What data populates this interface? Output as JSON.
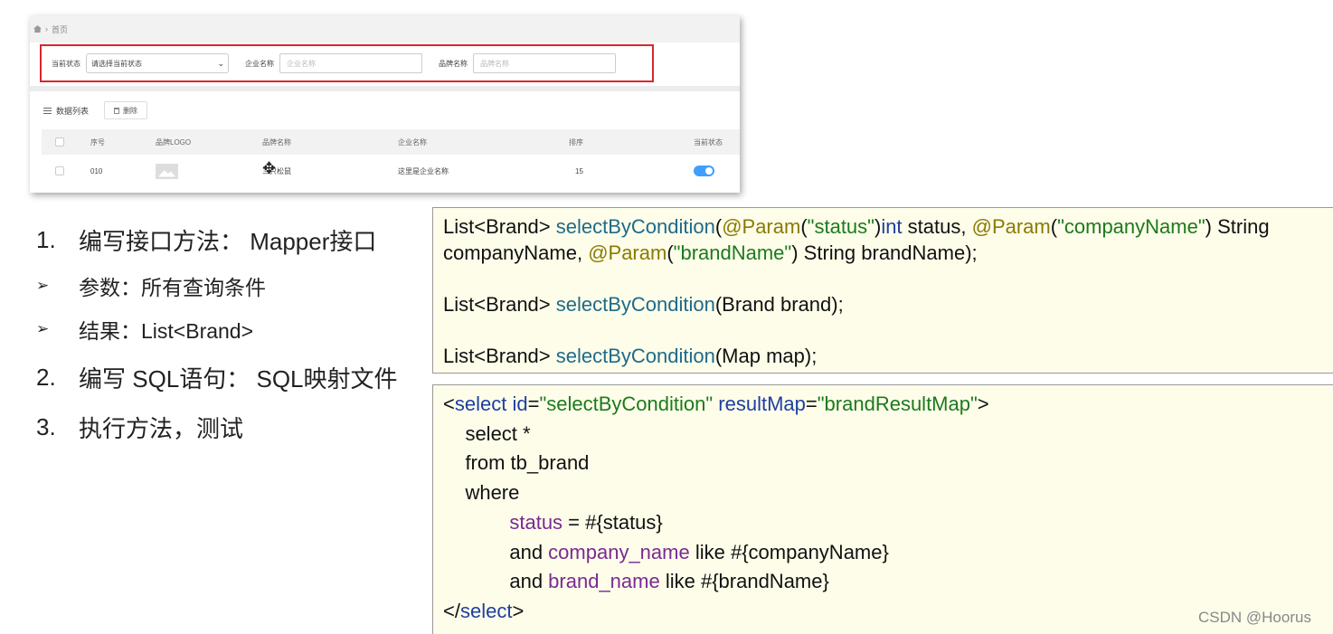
{
  "app": {
    "breadcrumb": "首页",
    "filter": {
      "status_label": "当前状态",
      "status_value": "请选择当前状态",
      "company_label": "企业名称",
      "company_placeholder": "企业名称",
      "brand_label": "品牌名称",
      "brand_placeholder": "品牌名称"
    },
    "toolbar": {
      "list_label": "数据列表",
      "delete_label": "删除"
    },
    "table": {
      "headers": [
        "序号",
        "品牌LOGO",
        "品牌名称",
        "企业名称",
        "排序",
        "当前状态"
      ],
      "rows": [
        {
          "id": "010",
          "brand": "三只松鼠",
          "company": "这里是企业名称",
          "order": "15",
          "status_on": true
        }
      ]
    }
  },
  "steps": {
    "s1": {
      "num": "1.",
      "text": "编写接口方法： Mapper接口"
    },
    "s1a": {
      "text": "参数：所有查询条件"
    },
    "s1b": {
      "text": "结果：List<Brand>"
    },
    "s2": {
      "num": "2.",
      "text": "编写 SQL语句： SQL映射文件"
    },
    "s3": {
      "num": "3.",
      "text": "执行方法，测试"
    }
  },
  "code1": {
    "l1": {
      "a": "List<Brand> ",
      "b": "selectByCondition",
      "c": "(",
      "d": "@Param",
      "e": "(",
      "f": "\"status\"",
      "g": ")",
      "h": "int",
      "i": " status, ",
      "j": "@Param",
      "k": "(",
      "l": "\"companyName\"",
      "m": ") String"
    },
    "l2": {
      "a": "companyName, ",
      "b": "@Param",
      "c": "(",
      "d": "\"brandName\"",
      "e": ") String brandName);"
    },
    "l3": {
      "a": "List<Brand> ",
      "b": "selectByCondition",
      "c": "(Brand brand);"
    },
    "l4": {
      "a": "List<Brand> ",
      "b": "selectByCondition",
      "c": "(Map map);"
    }
  },
  "code2": {
    "l1": {
      "a": "<",
      "b": "select",
      "c": " ",
      "d": "id",
      "e": "=",
      "f": "\"selectByCondition\"",
      "g": " ",
      "h": "resultMap",
      "i": "=",
      "j": "\"brandResultMap\"",
      "k": ">"
    },
    "l2": "    select *",
    "l3": "    from tb_brand",
    "l4": "    where",
    "l5": {
      "a": "            ",
      "b": "status",
      "c": " = #{status}"
    },
    "l6": {
      "a": "            and ",
      "b": "company_name",
      "c": " like #{companyName}"
    },
    "l7": {
      "a": "            and ",
      "b": "brand_name",
      "c": " like #{brandName}"
    },
    "l8": {
      "a": "</",
      "b": "select",
      "c": ">"
    }
  },
  "watermark": "CSDN @Hoorus",
  "colors": {
    "accent_blue": "#409eff",
    "highlight_red": "#d9262f",
    "code_bg": "#fdfdea"
  }
}
